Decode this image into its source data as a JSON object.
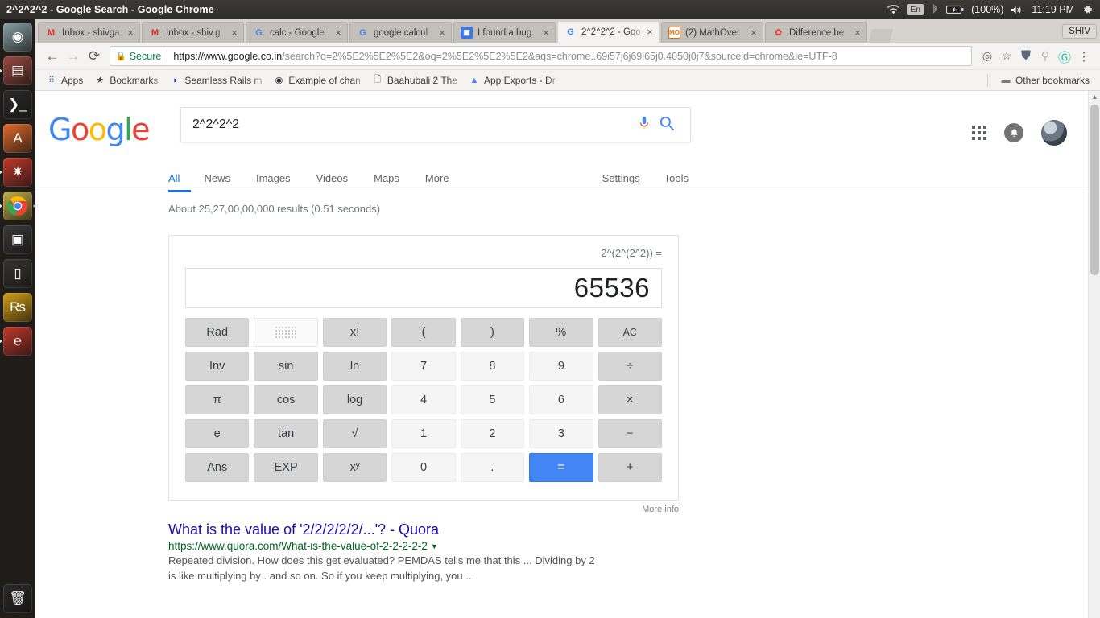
{
  "desktop": {
    "window_title": "2^2^2^2 - Google Search - Google Chrome",
    "tray": {
      "wifi_icon": "wifi-icon",
      "keyboard_layout": "En",
      "bluetooth_icon": "bluetooth-icon",
      "battery_icon": "battery-icon",
      "battery_percent": "(100%)",
      "volume_icon": "volume-icon",
      "clock": "11:19 PM",
      "settings_icon": "gear-icon"
    },
    "launcher": [
      {
        "name": "ubuntu-dash-icon",
        "label": "Dash home",
        "glyph": "◉",
        "bg": "#8ba3a8",
        "running": false
      },
      {
        "name": "files-icon",
        "label": "Files",
        "glyph": "▤",
        "bg": "#9b4a42",
        "running": true
      },
      {
        "name": "terminal-icon",
        "label": "Terminal",
        "glyph": "❯_",
        "bg": "#2b2b2b",
        "running": false
      },
      {
        "name": "software-center-icon",
        "label": "Ubuntu Software",
        "glyph": "A",
        "bg": "#e06b2c",
        "running": false
      },
      {
        "name": "system-settings-icon",
        "label": "System Settings",
        "glyph": "✷",
        "bg": "#c0392b",
        "running": true
      },
      {
        "name": "google-chrome-icon",
        "label": "Google Chrome",
        "glyph": "◍",
        "bg": "#c8b14a",
        "running": true
      },
      {
        "name": "screenshot-icon",
        "label": "Screenshot",
        "glyph": "▣",
        "bg": "#3a3a3a",
        "running": false
      },
      {
        "name": "device-icon",
        "label": "Device",
        "glyph": "▯",
        "bg": "#35352f",
        "running": false
      },
      {
        "name": "rupee-coin-icon",
        "label": "Coin",
        "glyph": "₨",
        "bg": "#d4a017",
        "running": false
      },
      {
        "name": "editor-icon",
        "label": "Editor",
        "glyph": "℮",
        "bg": "#c0392b",
        "running": true
      },
      {
        "name": "trash-icon",
        "label": "Trash",
        "glyph": "🗑",
        "bg": "#2a2a2a",
        "running": false
      }
    ]
  },
  "browser": {
    "tabs": [
      {
        "title": "Inbox - shivga",
        "favicon": "gmail-icon",
        "glyph": "M",
        "color": "#d93025",
        "active": false
      },
      {
        "title": "Inbox - shiv.g",
        "favicon": "gmail-icon",
        "glyph": "M",
        "color": "#d93025",
        "active": false
      },
      {
        "title": "calc - Google",
        "favicon": "google-icon",
        "glyph": "G",
        "color": "#4285f4",
        "active": false
      },
      {
        "title": "google calcul",
        "favicon": "google-icon",
        "glyph": "G",
        "color": "#4285f4",
        "active": false
      },
      {
        "title": "I found a bug",
        "favicon": "chat-icon",
        "glyph": "▣",
        "color": "#3b78e7",
        "active": false
      },
      {
        "title": "2^2^2^2 - Goo",
        "favicon": "google-icon",
        "glyph": "G",
        "color": "#4285f4",
        "active": true
      },
      {
        "title": "(2) MathOver",
        "favicon": "mathoverflow-icon",
        "glyph": "MO",
        "color": "#d9731a",
        "active": false
      },
      {
        "title": "Difference be",
        "favicon": "stackexchange-icon",
        "glyph": "✿",
        "color": "#d9453c",
        "active": false
      }
    ],
    "new_tab_button": "new-tab-button",
    "profile_button": "SHIV",
    "toolbar": {
      "back_icon": "back-arrow-icon",
      "forward_icon": "forward-arrow-icon",
      "reload_icon": "reload-icon",
      "security_label": "Secure",
      "url_prefix": "https://www.google.co.in",
      "url_path": "/search?q=2%5E2%5E2%5E2&oq=2%5E2%5E2%5E2&aqs=chrome..69i57j6j69i65j0.4050j0j7&sourceid=chrome&ie=UTF-8",
      "page_action_icon": "page-action-icon",
      "bookmark_star_icon": "star-icon",
      "extension_shield_icon": "shield-extension-icon",
      "extension_second_icon": "extension-icon",
      "extension_grammarly_icon": "grammarly-icon",
      "menu_icon": "three-dot-menu-icon"
    },
    "bookmarks": {
      "items": [
        {
          "label": "Apps",
          "icon": "apps-grid-icon",
          "glyph": "⠿"
        },
        {
          "label": "Bookmarks",
          "icon": "star-icon",
          "glyph": "★"
        },
        {
          "label": "Seamless Rails m",
          "icon": "page-icon",
          "glyph": "◗"
        },
        {
          "label": "Example of chan",
          "icon": "github-icon",
          "glyph": "◉"
        },
        {
          "label": "Baahubali 2 The ",
          "icon": "document-icon",
          "glyph": "🗋"
        },
        {
          "label": "App Exports - Dr",
          "icon": "drive-icon",
          "glyph": "▲"
        }
      ],
      "other_bookmarks": {
        "label": "Other bookmarks",
        "icon": "folder-icon",
        "glyph": "▣"
      }
    }
  },
  "google": {
    "logo": "Google",
    "search": {
      "value": "2^2^2^2",
      "placeholder": "Search",
      "mic_icon": "microphone-icon",
      "search_icon": "search-icon"
    },
    "account_bar": {
      "apps_icon": "google-apps-icon",
      "notifications_icon": "bell-icon",
      "avatar": "user-avatar"
    },
    "nav_tabs": [
      {
        "label": "All",
        "active": true
      },
      {
        "label": "News",
        "active": false
      },
      {
        "label": "Images",
        "active": false
      },
      {
        "label": "Videos",
        "active": false
      },
      {
        "label": "Maps",
        "active": false
      },
      {
        "label": "More",
        "active": false
      }
    ],
    "nav_right": [
      {
        "label": "Settings"
      },
      {
        "label": "Tools"
      }
    ],
    "result_stats": "About 25,27,00,00,000 results (0.51 seconds)",
    "calculator": {
      "expression": "2^(2^(2^2)) =",
      "display": "65536",
      "more_info": "More info",
      "keys": [
        {
          "label": "Rad",
          "name": "key-rad",
          "style": "fn"
        },
        {
          "label": "",
          "name": "key-keyboard",
          "style": "light",
          "icon": "keyboard-icon"
        },
        {
          "label": "x!",
          "name": "key-factorial",
          "style": "fn"
        },
        {
          "label": "(",
          "name": "key-open-paren",
          "style": "fn"
        },
        {
          "label": ")",
          "name": "key-close-paren",
          "style": "fn"
        },
        {
          "label": "%",
          "name": "key-percent",
          "style": "fn"
        },
        {
          "label": "AC",
          "name": "key-all-clear",
          "style": "fn",
          "sub": true
        },
        {
          "label": "Inv",
          "name": "key-inverse",
          "style": "fn"
        },
        {
          "label": "sin",
          "name": "key-sin",
          "style": "fn"
        },
        {
          "label": "ln",
          "name": "key-ln",
          "style": "fn"
        },
        {
          "label": "7",
          "name": "key-7",
          "style": "num"
        },
        {
          "label": "8",
          "name": "key-8",
          "style": "num"
        },
        {
          "label": "9",
          "name": "key-9",
          "style": "num"
        },
        {
          "label": "÷",
          "name": "key-divide",
          "style": "op"
        },
        {
          "label": "π",
          "name": "key-pi",
          "style": "fn"
        },
        {
          "label": "cos",
          "name": "key-cos",
          "style": "fn"
        },
        {
          "label": "log",
          "name": "key-log",
          "style": "fn"
        },
        {
          "label": "4",
          "name": "key-4",
          "style": "num"
        },
        {
          "label": "5",
          "name": "key-5",
          "style": "num"
        },
        {
          "label": "6",
          "name": "key-6",
          "style": "num"
        },
        {
          "label": "×",
          "name": "key-multiply",
          "style": "op"
        },
        {
          "label": "e",
          "name": "key-e",
          "style": "fn"
        },
        {
          "label": "tan",
          "name": "key-tan",
          "style": "fn"
        },
        {
          "label": "√",
          "name": "key-sqrt",
          "style": "fn"
        },
        {
          "label": "1",
          "name": "key-1",
          "style": "num"
        },
        {
          "label": "2",
          "name": "key-2",
          "style": "num"
        },
        {
          "label": "3",
          "name": "key-3",
          "style": "num"
        },
        {
          "label": "−",
          "name": "key-minus",
          "style": "op"
        },
        {
          "label": "Ans",
          "name": "key-answer",
          "style": "fn"
        },
        {
          "label": "EXP",
          "name": "key-exponent",
          "style": "fn"
        },
        {
          "label": "xʸ",
          "name": "key-power",
          "style": "fn"
        },
        {
          "label": "0",
          "name": "key-0",
          "style": "num"
        },
        {
          "label": ".",
          "name": "key-decimal",
          "style": "num"
        },
        {
          "label": "=",
          "name": "key-equals",
          "style": "eq"
        },
        {
          "label": "+",
          "name": "key-plus",
          "style": "op"
        }
      ]
    },
    "results": [
      {
        "title": "What is the value of '2/2/2/2/2/...'? - Quora",
        "url": "https://www.quora.com/What-is-the-value-of-2-2-2-2-2",
        "snippet_line1": "Repeated division. How does this get evaluated? PEMDAS tells me that this ... Dividing by 2 is like",
        "snippet_line2": "multiplying by . and so on. So if you keep multiplying, you ..."
      }
    ]
  }
}
